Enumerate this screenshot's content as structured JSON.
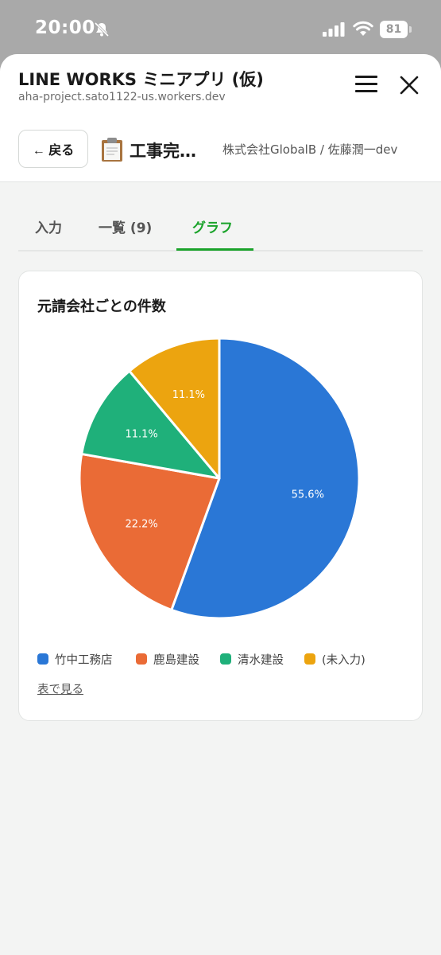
{
  "status_bar": {
    "time": "20:00",
    "battery": "81",
    "icons": [
      "bell-muted-icon",
      "signal-icon",
      "wifi-icon",
      "battery-icon"
    ]
  },
  "header": {
    "title": "LINE WORKS ミニアプリ (仮)",
    "url": "aha-project.sato1122-us.workers.dev",
    "menu_icon": "hamburger-menu-icon",
    "close_icon": "close-icon"
  },
  "nav": {
    "back_label": "← 戻る",
    "form_icon": "clipboard-icon",
    "form_title": "工事完…",
    "org_user": "株式会社GlobalB / 佐藤潤一dev"
  },
  "tabs": [
    {
      "label": "入力",
      "active": false
    },
    {
      "label": "一覧 (9)",
      "active": false
    },
    {
      "label": "グラフ",
      "active": true
    }
  ],
  "colors": {
    "accent": "#1aa32a"
  },
  "card": {
    "title": "元請会社ごとの件数",
    "table_link": "表で見る"
  },
  "chart_data": {
    "type": "pie",
    "title": "元請会社ごとの件数",
    "total": 9,
    "legend_position": "bottom",
    "slices": [
      {
        "name": "竹中工務店",
        "value": 5,
        "percent_label": "55.6%",
        "color": "#2a77d6"
      },
      {
        "name": "鹿島建設",
        "value": 2,
        "percent_label": "22.2%",
        "color": "#ea6b36"
      },
      {
        "name": "清水建設",
        "value": 1,
        "percent_label": "11.1%",
        "color": "#1fb07a"
      },
      {
        "name": "(未入力)",
        "value": 1,
        "percent_label": "11.1%",
        "color": "#eca40f"
      }
    ]
  }
}
